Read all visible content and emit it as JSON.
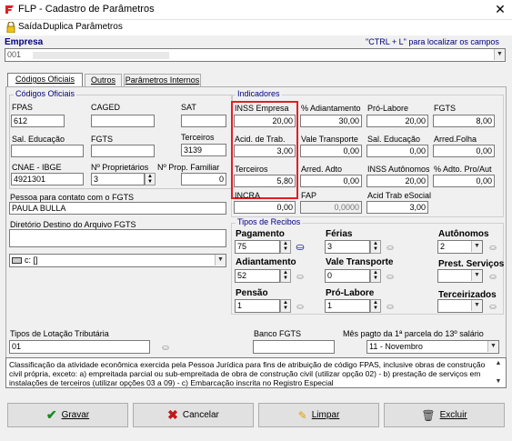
{
  "window": {
    "title": "FLP - Cadastro de Parâmetros",
    "close": "✕"
  },
  "menu": {
    "exit": "Saída",
    "duplicate": "Duplica Parâmetros"
  },
  "empresa": {
    "label": "Empresa",
    "hint": "\"CTRL + L\" para localizar os campos",
    "value": "001"
  },
  "tabs": [
    {
      "label": "Códigos Oficiais",
      "active": true
    },
    {
      "label": "Outros"
    },
    {
      "label": "Parâmetros Internos"
    }
  ],
  "codigos": {
    "group_title": "Códigos Oficiais",
    "fpas_label": "FPAS",
    "fpas_value": "612",
    "caged_label": "CAGED",
    "caged_value": "",
    "sat_label": "SAT",
    "sat_value": "",
    "sal_educ_label": "Sal. Educação",
    "sal_educ_value": "",
    "fgts_label": "FGTS",
    "fgts_value": "",
    "terceiros_label": "Terceiros",
    "terceiros_value": "3139",
    "cnae_label": "CNAE - IBGE",
    "cnae_value": "4921301",
    "nprop_label": "Nº Proprietários",
    "nprop_value": "3",
    "nprop_fam_label": "Nº Prop. Familiar",
    "nprop_fam_value": "0"
  },
  "contato": {
    "label": "Pessoa para contato com o FGTS",
    "value": "PAULA BULLA"
  },
  "diretorio": {
    "label": "Diretório Destino do Arquivo FGTS",
    "value": "",
    "drive": "c: []"
  },
  "indicadores": {
    "group_title": "Indicadores",
    "inss_empresa_label": "INSS Empresa",
    "inss_empresa_value": "20,00",
    "adiantamento_label": "% Adiantamento",
    "adiantamento_value": "30,00",
    "pro_labore_label": "Pró-Labore",
    "pro_labore_value": "20,00",
    "fgts_label": "FGTS",
    "fgts_value": "8,00",
    "acid_trab_label": "Acid. de Trab.",
    "acid_trab_value": "3,00",
    "vale_transp_label": "Vale Transporte",
    "vale_transp_value": "0,00",
    "sal_educ_label": "Sal. Educação",
    "sal_educ_value": "0,00",
    "arred_folha_label": "Arred.Folha",
    "arred_folha_value": "0,00",
    "terceiros_label": "Terceiros",
    "terceiros_value": "5,80",
    "arred_adto_label": "Arred. Adto",
    "arred_adto_value": "0,00",
    "inss_auton_label": "INSS Autônomos",
    "inss_auton_value": "20,00",
    "adto_pro_label": "% Adto. Pro/Aut",
    "adto_pro_value": "0,00",
    "incra_label": "INCRA",
    "incra_value": "0,00",
    "fap_label": "FAP",
    "fap_value": "0,0000",
    "acid_esocial_label": "Acid Trab eSocial",
    "acid_esocial_value": "3,00"
  },
  "recibos": {
    "group_title": "Tipos de Recibos",
    "pagamento_label": "Pagamento",
    "pagamento_value": "75",
    "ferias_label": "Férias",
    "ferias_value": "3",
    "autonomos_label": "Autônomos",
    "autonomos_value": "2",
    "adiantamento_label": "Adiantamento",
    "adiantamento_value": "52",
    "vale_transp_label": "Vale Transporte",
    "vale_transp_value": "0",
    "prest_serv_label": "Prest. Serviços",
    "prest_serv_value": "",
    "pensao_label": "Pensão",
    "pensao_value": "1",
    "pro_labore_label": "Pró-Labore",
    "pro_labore_value": "1",
    "terceirizados_label": "Terceirizados",
    "terceirizados_value": ""
  },
  "lotacao": {
    "label": "Tipos de Lotação Tributária",
    "value": "01"
  },
  "banco": {
    "label": "Banco FGTS",
    "value": ""
  },
  "mes13": {
    "label": "Mês pagto da 1ª parcela do 13º salário",
    "value": "11 - Novembro"
  },
  "description": "Classificação da atividade econômica exercida pela Pessoa Jurídica para fins de atribuição de código FPAS, inclusive obras de construção civil própria, exceto: a) empreitada parcial ou sub-empreitada de obra de construção civil (utilizar opção 02) - b) prestação de serviços em instalações de terceiros (utilizar opções 03 a 09) - c) Embarcação inscrita no Registro Especial",
  "buttons": {
    "gravar": "Gravar",
    "cancelar": "Cancelar",
    "limpar": "Limpar",
    "excluir": "Excluir"
  },
  "colors": {
    "accent_blue": "#000080",
    "highlight_red": "#e31e24",
    "icon_red": "#e31e24"
  }
}
